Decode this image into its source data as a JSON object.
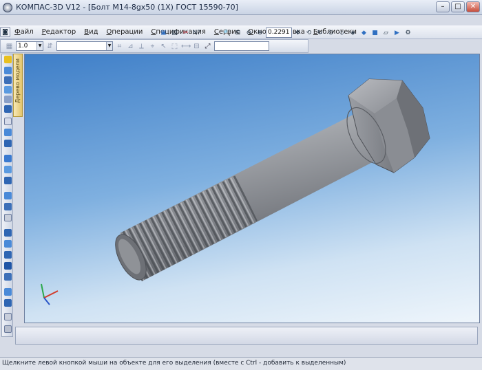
{
  "window": {
    "title": "КОМПАС-3D V12 - [Болт М14-8gx50 (1Х) ГОСТ 15590-70]"
  },
  "menu": [
    "Файл",
    "Редактор",
    "Вид",
    "Операции",
    "Спецификация",
    "Сервис",
    "Окно",
    "Справка",
    "Библиотеки"
  ],
  "toolbar": {
    "zoom_value": "0.2291"
  },
  "toolbar2": {
    "step_value": "1.0"
  },
  "tree_tab_label": "Дерево модели",
  "statusbar": {
    "text": "Щелкните левой кнопкой мыши на объекте для его выделения (вместе с Ctrl - добавить к выделенным)"
  },
  "colors": {
    "viewport_top": "#3f7fc8",
    "viewport_bottom": "#eef5fb",
    "bolt_body": "#8e9095"
  }
}
